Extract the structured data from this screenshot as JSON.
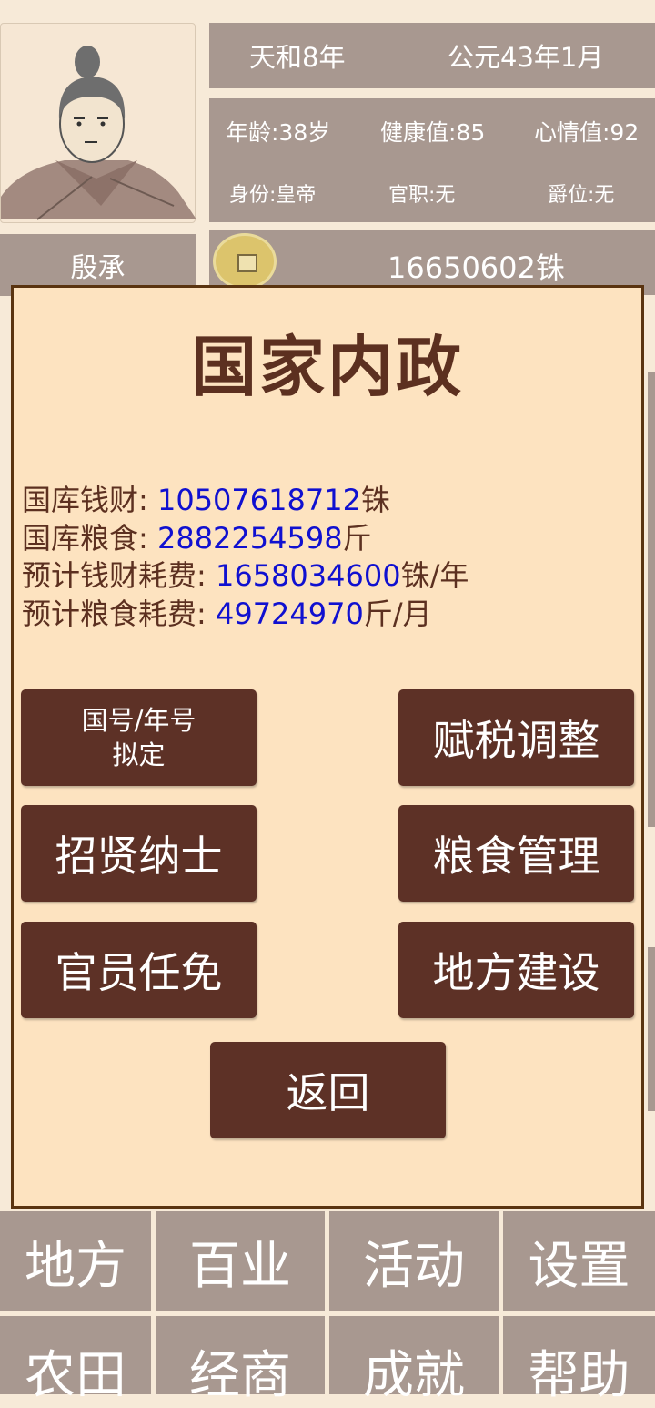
{
  "header": {
    "name": "殷承",
    "reign_year": "天和8年",
    "gregorian_date": "公元43年1月",
    "age": "年龄:38岁",
    "health": "健康值:85",
    "mood": "心情值:92",
    "identity": "身份:皇帝",
    "office": "官职:无",
    "rank": "爵位:无",
    "money": "16650602铢"
  },
  "modal": {
    "title": "国家内政",
    "treasury_money_label": "国库钱财:",
    "treasury_money_value": "10507618712",
    "treasury_money_unit": "铢",
    "treasury_grain_label": "国库粮食:",
    "treasury_grain_value": "2882254598",
    "treasury_grain_unit": "斤",
    "money_cost_label": "预计钱财耗费:",
    "money_cost_value": "1658034600",
    "money_cost_unit": "铢/年",
    "grain_cost_label": "预计粮食耗费:",
    "grain_cost_value": "49724970",
    "grain_cost_unit": "斤/月",
    "buttons": {
      "era_line1": "国号/年号",
      "era_line2": "拟定",
      "tax": "赋税调整",
      "recruit": "招贤纳士",
      "grain": "粮食管理",
      "officials": "官员任免",
      "construction": "地方建设",
      "back": "返回"
    }
  },
  "bottom_nav": {
    "row1": [
      "地方",
      "百业",
      "活动",
      "设置"
    ],
    "row2": [
      "农田",
      "经商",
      "成就",
      "帮助"
    ]
  },
  "colors": {
    "background": "#f7ead8",
    "panel": "#a89890",
    "modal_bg": "#fde3c0",
    "button": "#5d3126",
    "number_blue": "#1010d0",
    "title_brown": "#5c3020"
  }
}
